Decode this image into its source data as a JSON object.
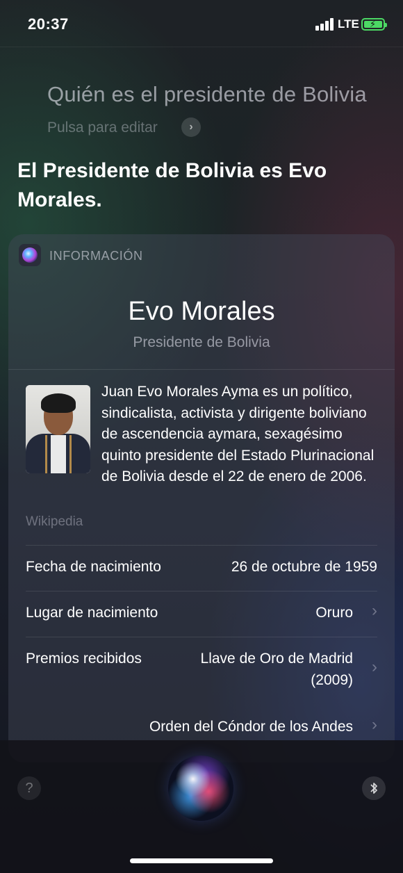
{
  "status_bar": {
    "time": "20:37",
    "network": "LTE",
    "signal_bars": 4,
    "battery": "charging"
  },
  "query": {
    "text": "Quién es el presidente de Bolivia",
    "edit_hint": "Pulsa para editar"
  },
  "answer": "El Presidente de Bolivia es Evo Morales.",
  "card": {
    "header_label": "INFORMACIÓN",
    "name": "Evo Morales",
    "subtitle": "Presidente de Bolivia",
    "bio": "Juan Evo Morales Ayma es un político, sindicalista, activista y dirigente boliviano de ascendencia aymara, sexagésimo quinto presidente del Estado Plurinacional de Bolivia desde el 22 de enero de 2006.",
    "source": "Wikipedia",
    "facts": [
      {
        "label": "Fecha de nacimiento",
        "value": "26 de octubre de 1959"
      },
      {
        "label": "Lugar de nacimiento",
        "value": "Oruro"
      },
      {
        "label": "Premios recibidos",
        "value": "Llave de Oro de Madrid (2009)"
      },
      {
        "label": "",
        "value": "Orden del Cóndor de los Andes"
      }
    ]
  },
  "icons": {
    "siri": "siri-icon",
    "chevron": "chevron-right-icon",
    "help": "help-icon",
    "bluetooth": "bluetooth-icon"
  }
}
